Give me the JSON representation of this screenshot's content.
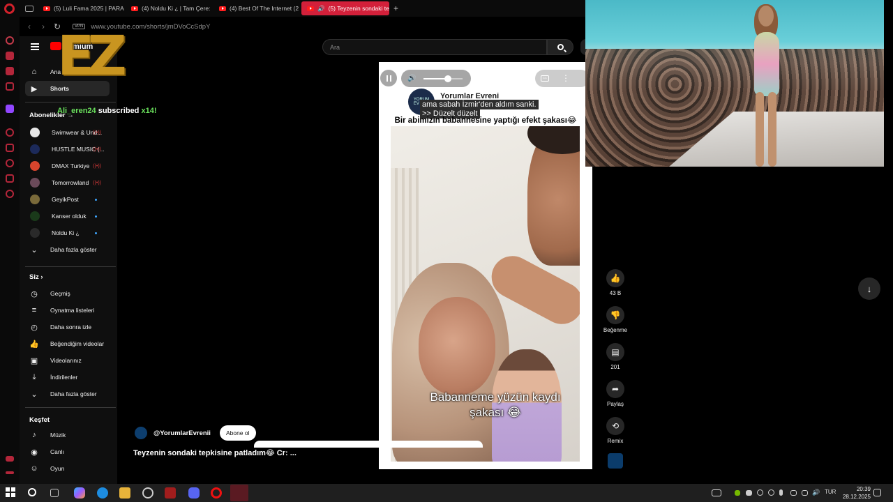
{
  "browser": {
    "tabs": [
      {
        "label": "(5) Luli Fama 2025 | PARA"
      },
      {
        "label": "(4) Noldu Ki ¿ | Tam Çere:"
      },
      {
        "label": "(4) Best Of The Internet (2"
      },
      {
        "label": "(5) Teyzenin sondaki te"
      }
    ],
    "new_tab": "+",
    "vpn": "VPN",
    "url": "www.youtube.com/shorts/jmDVoCcSdpY"
  },
  "youtube": {
    "logo_text": "mium",
    "search_placeholder": "Ara",
    "nav": {
      "home": "Ana Sayfa",
      "shorts": "Shorts",
      "subscriptions_header": "Abonelikler",
      "subscriptions": [
        {
          "name": "Swimwear & Und...",
          "color": "#e8e8e8",
          "live": true
        },
        {
          "name": "HUSTLE MUSIC (...",
          "color": "#1c2a5a",
          "live": true
        },
        {
          "name": "DMAX Turkiye",
          "color": "#d6452d",
          "live": true
        },
        {
          "name": "Tomorrowland",
          "color": "#6b4a5a",
          "live": true
        },
        {
          "name": "GeyikPost",
          "color": "#7a6a3a",
          "live": false
        },
        {
          "name": "Kanser olduk",
          "color": "#1a3a1a",
          "live": false
        },
        {
          "name": "Noldu Ki ¿",
          "color": "#2a2a2a",
          "live": false
        }
      ],
      "show_more_subs": "Daha fazla göster",
      "you_header": "Siz",
      "you_items": [
        {
          "label": "Geçmiş",
          "icon": "history-icon"
        },
        {
          "label": "Oynatma listeleri",
          "icon": "playlists-icon"
        },
        {
          "label": "Daha sonra izle",
          "icon": "watch-later-icon"
        },
        {
          "label": "Beğendiğim videolar",
          "icon": "like-icon"
        },
        {
          "label": "Videolarınız",
          "icon": "your-videos-icon"
        },
        {
          "label": "İndirilenler",
          "icon": "download-icon"
        },
        {
          "label": "Daha fazla göster",
          "icon": "chevron-down-icon"
        }
      ],
      "explore_header": "Keşfet",
      "explore_items": [
        {
          "label": "Müzik",
          "icon": "music-icon"
        },
        {
          "label": "Canlı",
          "icon": "live-icon"
        },
        {
          "label": "Oyun",
          "icon": "gaming-icon"
        }
      ]
    },
    "overlay": {
      "logo": "EZ",
      "sub_user": "Ali_eren24",
      "sub_text": "subscribed",
      "sub_count": "x14!"
    },
    "short": {
      "channel_name": "Yorumlar Evreni",
      "caption_line1": "ama sabah İzmir'den aldım sanki.",
      "caption_line2": ">> Düzelt düzelt",
      "title_on_video": "Bir abimizin babannesine yaptığı efekt şakası😂",
      "overlay_caption": "Babanneme yüzün kaydı şakası 😂",
      "volume_fraction": 0.62,
      "channel_handle": "@YorumlarEvrenii",
      "subscribe_label": "Abone ol",
      "title": "Teyzenin sondaki tepkisine patladım😂 Cr: ..."
    },
    "actions": {
      "likes": "43 B",
      "dislike": "Beğenme",
      "comments": "201",
      "share": "Paylaş",
      "remix": "Remix"
    }
  },
  "taskbar": {
    "lang": "TUR",
    "time": "20:39",
    "date": "28.12.2025"
  }
}
